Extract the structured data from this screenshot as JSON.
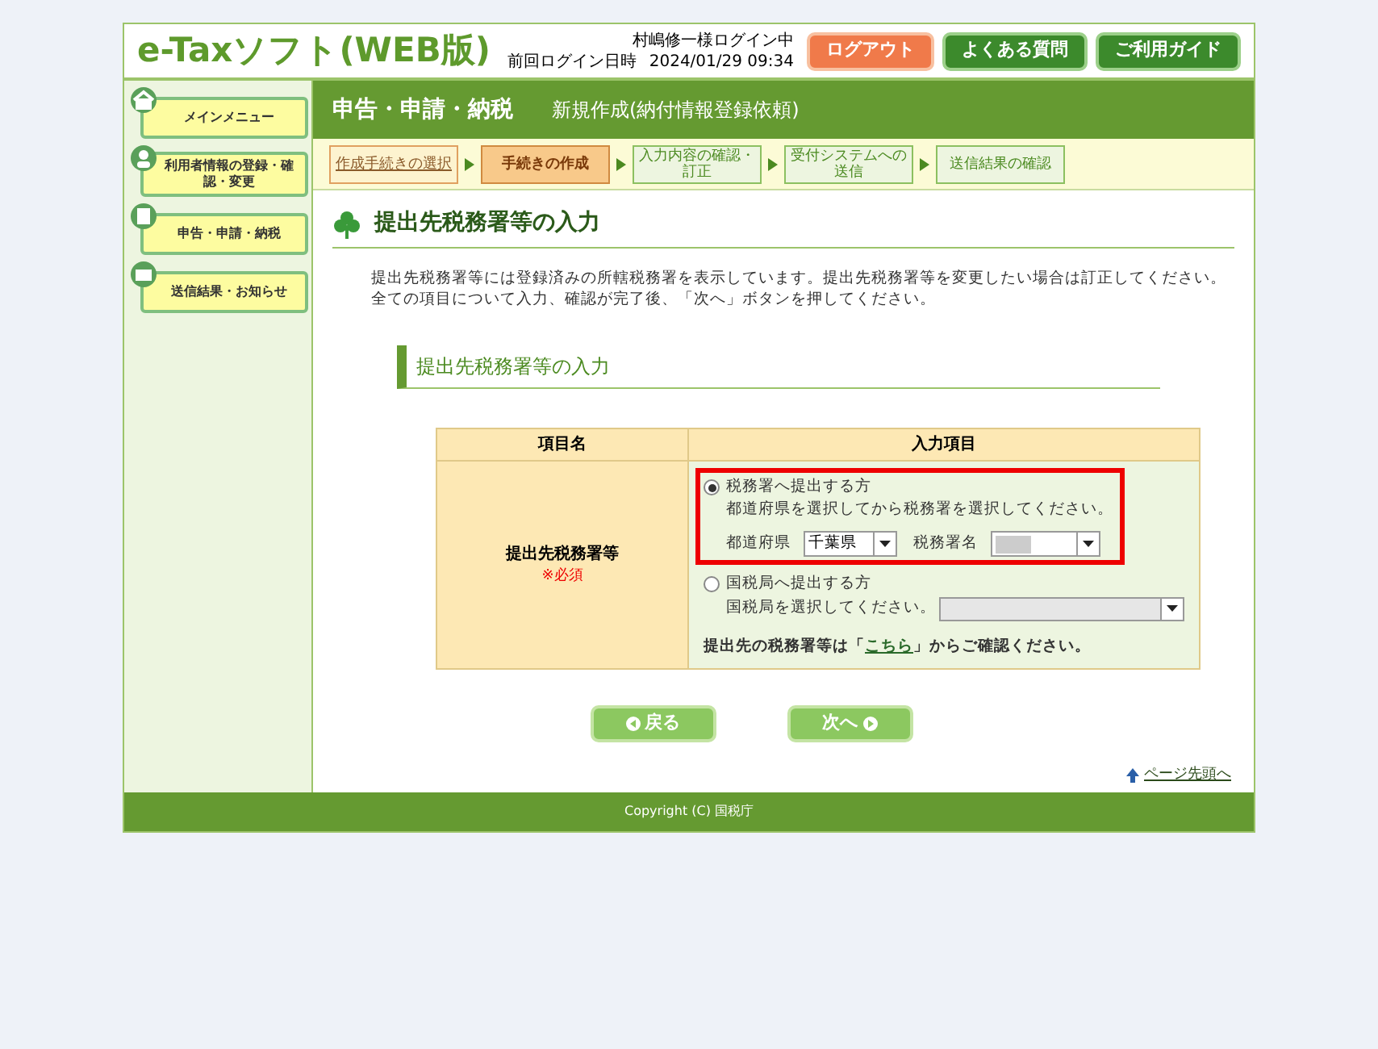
{
  "header": {
    "logo": "e-Taxソフト(WEB版)",
    "user": "村嶋修一様ログイン中",
    "last_login_label": "前回ログイン日時",
    "last_login": "2024/01/29 09:34",
    "buttons": [
      {
        "label": "ログアウト",
        "kind": "logout"
      },
      {
        "label": "よくある質問",
        "kind": "nav"
      },
      {
        "label": "ご利用ガイド",
        "kind": "nav"
      }
    ]
  },
  "sidebar": {
    "items": [
      {
        "label": "メインメニュー"
      },
      {
        "label": "利用者情報の登録・確認・変更"
      },
      {
        "label": "申告・申請・納税"
      },
      {
        "label": "送信結果・お知らせ"
      }
    ]
  },
  "title_bar": {
    "title": "申告・申請・納税",
    "subtitle": "新規作成(納付情報登録依頼)"
  },
  "steps": [
    {
      "label": "作成手続きの選択",
      "done": true,
      "selected": false
    },
    {
      "label": "手続きの作成",
      "done": false,
      "selected": true
    },
    {
      "label": "入力内容の確認・訂正",
      "done": false,
      "selected": false
    },
    {
      "label": "受付システムへの送信",
      "done": false,
      "selected": false
    },
    {
      "label": "送信結果の確認",
      "done": false,
      "selected": false
    }
  ],
  "page_title": "提出先税務署等の入力",
  "intro": [
    "提出先税務署等には登録済みの所轄税務署を表示しています。提出先税務署等を変更したい場合は訂正してください。",
    "全ての項目について入力、確認が完了後、「次へ」ボタンを押してください。"
  ],
  "section_title": "提出先税務署等の入力",
  "table": {
    "columns": [
      "項目名",
      "入力項目"
    ],
    "row_label": "提出先税務署等",
    "required": "※必須",
    "options": [
      {
        "label": "税務署へ提出する方",
        "hint": "都道府県を選択してから税務署を選択してください。",
        "selected": true,
        "highlighted": true,
        "selects": [
          {
            "label": "都道府県",
            "value": "千葉県",
            "masked": false,
            "disabled": false
          },
          {
            "label": "税務署名",
            "masked": true,
            "disabled": false
          }
        ]
      },
      {
        "label": "国税局へ提出する方",
        "hint": "国税局を選択してください。",
        "selected": false,
        "highlighted": false,
        "selects": [
          {
            "masked": false,
            "disabled": true
          }
        ]
      }
    ],
    "note_before": "提出先の税務署等は「",
    "note_link": "こちら",
    "note_after": "」からご確認ください。"
  },
  "buttons": [
    {
      "label": "戻る",
      "kind": "back"
    },
    {
      "label": "次へ",
      "kind": "next"
    }
  ],
  "page_top_link": "ページ先頭へ",
  "footer": "Copyright (C) 国税庁"
}
